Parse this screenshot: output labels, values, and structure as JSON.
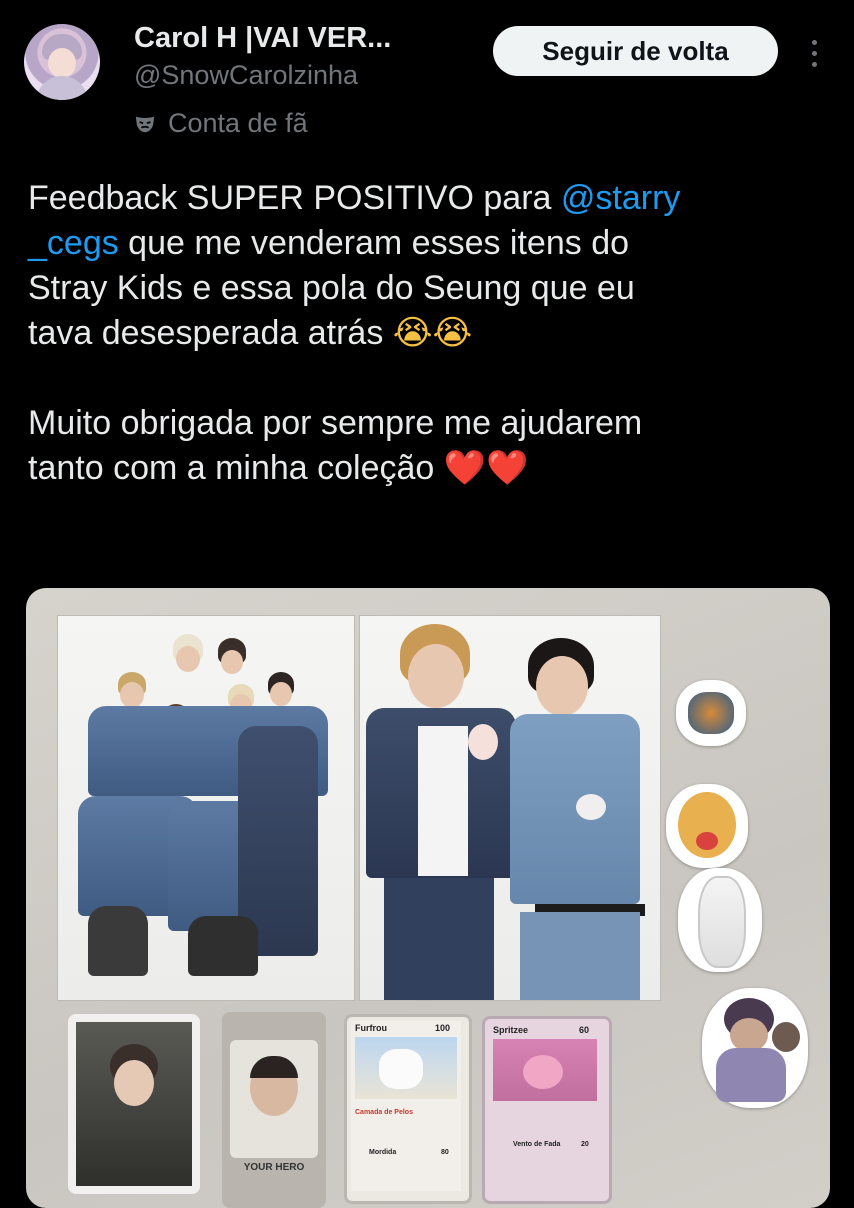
{
  "user": {
    "display_name": "Carol H |VAI VER...",
    "handle": "@SnowCarolzinha",
    "label": "Conta de fã",
    "follow_button": "Seguir de volta"
  },
  "tweet": {
    "line1_a": "Feedback SUPER POSITIVO para ",
    "mention_a": "@starry",
    "mention_b": "_cegs",
    "line2_b": " que me venderam esses itens do",
    "line3": "Stray Kids e essa pola do Seung que eu",
    "line4": "tava desesperada atrás ",
    "line4_emoji": "😭😭",
    "line5": "Muito obrigada por sempre me ajudarem",
    "line6": "tanto com a minha coleção ",
    "line6_emoji": "❤️❤️"
  },
  "media": {
    "card1_name": "Furfrou",
    "card1_hp": "100",
    "card1_attack": "Mordida",
    "card1_damage": "80",
    "card1_ability": "Camada de Pelos",
    "card2_name": "Spritzee",
    "card2_hp": "60",
    "card2_attack": "Vento de Fada",
    "card2_damage": "20",
    "photocard_caption": "YOUR HERO"
  }
}
